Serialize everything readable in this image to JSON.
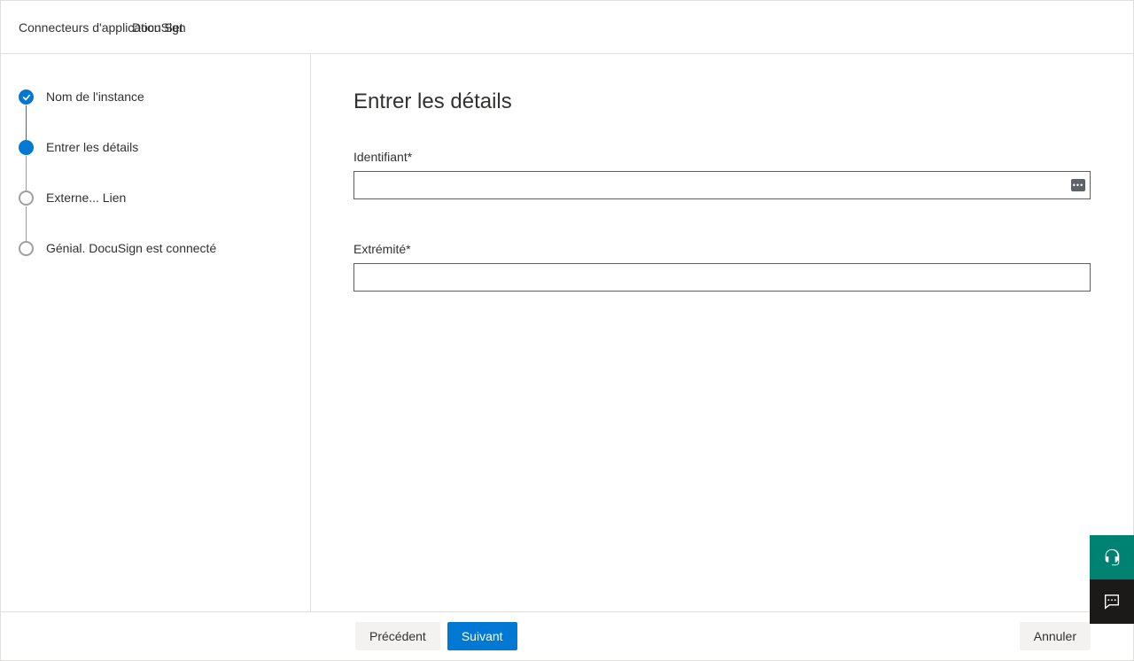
{
  "header": {
    "title": "Connecteurs d'application Set",
    "subtitle": "DocuSign"
  },
  "steps": [
    {
      "label": "Nom de l'instance",
      "state": "completed"
    },
    {
      "label": "Entrer les détails",
      "state": "current"
    },
    {
      "label": "Externe... Lien",
      "state": "upcoming"
    },
    {
      "label": "Génial. DocuSign est connecté",
      "state": "upcoming"
    }
  ],
  "main": {
    "title": "Entrer les détails",
    "fields": {
      "identifier": {
        "label": "Identifiant*",
        "value": ""
      },
      "endpoint": {
        "label": "Extrémité*",
        "value": ""
      }
    }
  },
  "footer": {
    "previous": "Précédent",
    "next": "Suivant",
    "cancel": "Annuler"
  }
}
